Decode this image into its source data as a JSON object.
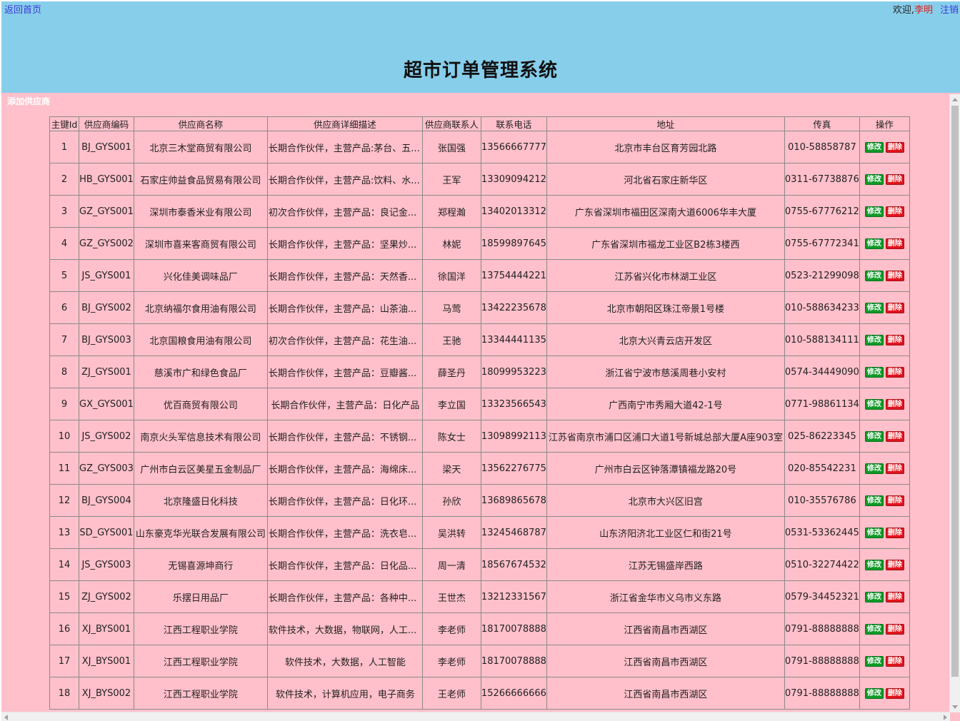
{
  "header": {
    "home_link": "返回首页",
    "welcome": "欢迎,",
    "username": "李明",
    "logout": "注销",
    "title": "超市订单管理系统"
  },
  "toolbar": {
    "add_supplier": "添加供应商"
  },
  "colors": {
    "header_bg": "#87ceeb",
    "page_bg": "#ffc0cb",
    "edit_btn": "#0f9a27",
    "delete_btn": "#e0141d"
  },
  "table": {
    "columns": [
      "主键Id",
      "供应商编码",
      "供应商名称",
      "供应商详细描述",
      "供应商联系人",
      "联系电话",
      "地址",
      "传真",
      "操作"
    ],
    "edit_label": "修改",
    "delete_label": "删除",
    "rows": [
      {
        "id": "1",
        "code": "BJ_GYS001",
        "name": "北京三木堂商贸有限公司",
        "desc": "长期合作伙伴，主营产品:茅台、五...",
        "contact": "张国强",
        "phone": "13566667777",
        "address": "北京市丰台区育芳园北路",
        "fax": "010-58858787"
      },
      {
        "id": "2",
        "code": "HB_GYS001",
        "name": "石家庄帅益食品贸易有限公司",
        "desc": "长期合作伙伴，主营产品:饮料、水...",
        "contact": "王军",
        "phone": "13309094212",
        "address": "河北省石家庄新华区",
        "fax": "0311-67738876"
      },
      {
        "id": "3",
        "code": "GZ_GYS001",
        "name": "深圳市泰香米业有限公司",
        "desc": "初次合作伙伴，主营产品：良记金...",
        "contact": "郑程瀚",
        "phone": "13402013312",
        "address": "广东省深圳市福田区深南大道6006华丰大厦",
        "fax": "0755-67776212"
      },
      {
        "id": "4",
        "code": "GZ_GYS002",
        "name": "深圳市喜来客商贸有限公司",
        "desc": "长期合作伙伴，主营产品：坚果炒...",
        "contact": "林妮",
        "phone": "18599897645",
        "address": "广东省深圳市福龙工业区B2栋3楼西",
        "fax": "0755-67772341"
      },
      {
        "id": "5",
        "code": "JS_GYS001",
        "name": "兴化佳美调味品厂",
        "desc": "长期合作伙伴，主营产品：天然香...",
        "contact": "徐国洋",
        "phone": "13754444221",
        "address": "江苏省兴化市林湖工业区",
        "fax": "0523-21299098"
      },
      {
        "id": "6",
        "code": "BJ_GYS002",
        "name": "北京纳福尔食用油有限公司",
        "desc": "长期合作伙伴，主营产品：山茶油...",
        "contact": "马莺",
        "phone": "13422235678",
        "address": "北京市朝阳区珠江帝景1号楼",
        "fax": "010-588634233"
      },
      {
        "id": "7",
        "code": "BJ_GYS003",
        "name": "北京国粮食用油有限公司",
        "desc": "初次合作伙伴，主营产品：花生油...",
        "contact": "王驰",
        "phone": "13344441135",
        "address": "北京大兴青云店开发区",
        "fax": "010-588134111"
      },
      {
        "id": "8",
        "code": "ZJ_GYS001",
        "name": "慈溪市广和绿色食品厂",
        "desc": "长期合作伙伴，主营产品：豆瓣酱...",
        "contact": "薛圣丹",
        "phone": "18099953223",
        "address": "浙江省宁波市慈溪周巷小安村",
        "fax": "0574-34449090"
      },
      {
        "id": "9",
        "code": "GX_GYS001",
        "name": "优百商贸有限公司",
        "desc": "长期合作伙伴，主营产品：日化产品",
        "contact": "李立国",
        "phone": "13323566543",
        "address": "广西南宁市秀厢大道42-1号",
        "fax": "0771-98861134",
        "desc_center": true
      },
      {
        "id": "10",
        "code": "JS_GYS002",
        "name": "南京火头军信息技术有限公司",
        "desc": "长期合作伙伴，主营产品：不锈钢...",
        "contact": "陈女士",
        "phone": "13098992113",
        "address": "江苏省南京市浦口区浦口大道1号新城总部大厦A座903室",
        "fax": "025-86223345"
      },
      {
        "id": "11",
        "code": "GZ_GYS003",
        "name": "广州市白云区美星五金制品厂",
        "desc": "长期合作伙伴，主营产品：海绵床...",
        "contact": "梁天",
        "phone": "13562276775",
        "address": "广州市白云区钟落潭镇福龙路20号",
        "fax": "020-85542231"
      },
      {
        "id": "12",
        "code": "BJ_GYS004",
        "name": "北京隆盛日化科技",
        "desc": "长期合作伙伴，主营产品：日化环...",
        "contact": "孙欣",
        "phone": "13689865678",
        "address": "北京市大兴区旧宫",
        "fax": "010-35576786"
      },
      {
        "id": "13",
        "code": "SD_GYS001",
        "name": "山东豪克华光联合发展有限公司",
        "desc": "长期合作伙伴，主营产品：洗衣皂...",
        "contact": "吴洪转",
        "phone": "13245468787",
        "address": "山东济阳济北工业区仁和街21号",
        "fax": "0531-53362445"
      },
      {
        "id": "14",
        "code": "JS_GYS003",
        "name": "无锡喜源坤商行",
        "desc": "长期合作伙伴，主营产品：日化品...",
        "contact": "周一清",
        "phone": "18567674532",
        "address": "江苏无锡盛岸西路",
        "fax": "0510-32274422"
      },
      {
        "id": "15",
        "code": "ZJ_GYS002",
        "name": "乐摆日用品厂",
        "desc": "长期合作伙伴，主营产品：各种中...",
        "contact": "王世杰",
        "phone": "13212331567",
        "address": "浙江省金华市义乌市义东路",
        "fax": "0579-34452321"
      },
      {
        "id": "16",
        "code": "XJ_BYS001",
        "name": "江西工程职业学院",
        "desc": "软件技术，大数据，物联网，人工...",
        "contact": "李老师",
        "phone": "18170078888",
        "address": "江西省南昌市西湖区",
        "fax": "0791-88888888"
      },
      {
        "id": "17",
        "code": "XJ_BYS001",
        "name": "江西工程职业学院",
        "desc": "软件技术，大数据，人工智能",
        "contact": "李老师",
        "phone": "18170078888",
        "address": "江西省南昌市西湖区",
        "fax": "0791-88888888",
        "desc_center": true
      },
      {
        "id": "18",
        "code": "XJ_BYS002",
        "name": "江西工程职业学院",
        "desc": "软件技术，计算机应用，电子商务",
        "contact": "王老师",
        "phone": "15266666666",
        "address": "江西省南昌市西湖区",
        "fax": "0791-88888888",
        "desc_center": true
      }
    ]
  }
}
